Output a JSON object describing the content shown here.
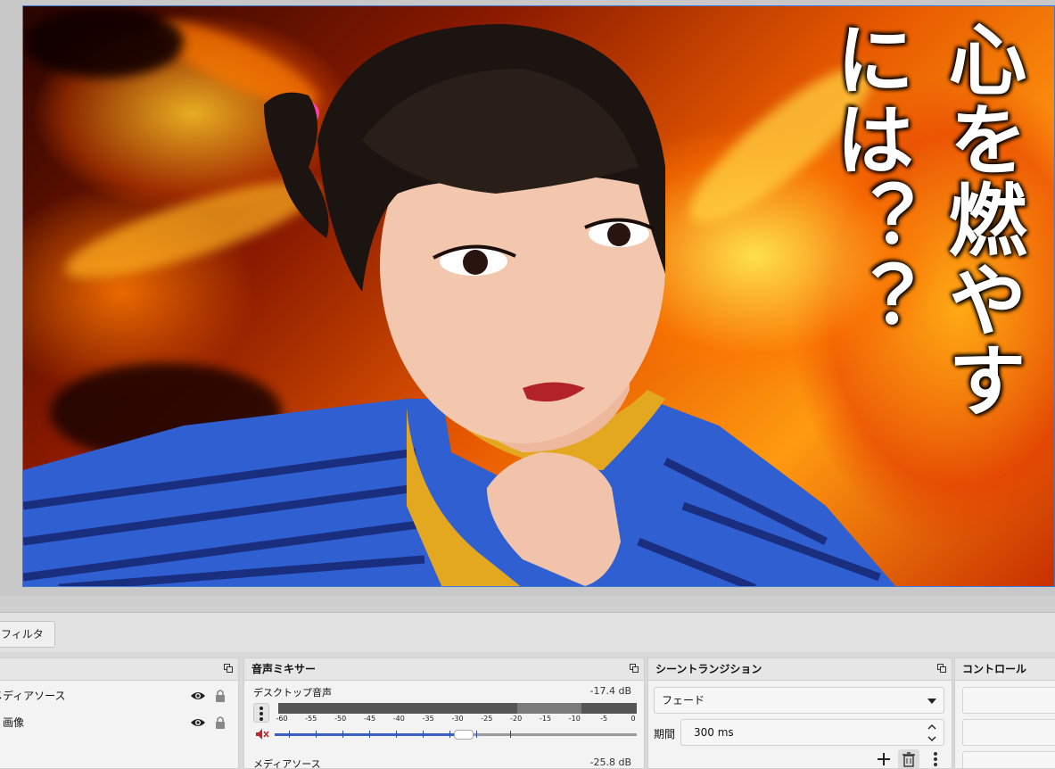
{
  "preview": {
    "title_text": "心を燃やす\nには？？"
  },
  "filter_button": {
    "label": "フィルタ"
  },
  "sources": {
    "items": [
      {
        "label": "メディアソース"
      },
      {
        "label": "画像"
      }
    ]
  },
  "audio_mixer": {
    "title": "音声ミキサー",
    "tracks": [
      {
        "name": "デスクトップ音声",
        "db": "-17.4 dB",
        "volume_fraction": 0.52
      },
      {
        "name": "メディアソース",
        "db": "-25.8 dB"
      }
    ],
    "meter_ticks": [
      "-60",
      "-55",
      "-50",
      "-45",
      "-40",
      "-35",
      "-30",
      "-25",
      "-20",
      "-15",
      "-10",
      "-5",
      "0"
    ]
  },
  "scene_transitions": {
    "title": "シーントランジション",
    "transition_value": "フェード",
    "duration_label": "期間",
    "duration_value": "300 ms"
  },
  "controls": {
    "title": "コントロール"
  },
  "colors": {
    "accent": "#3c5fc4",
    "selection_border": "#3a7bd5",
    "mute": "#c0272d"
  }
}
